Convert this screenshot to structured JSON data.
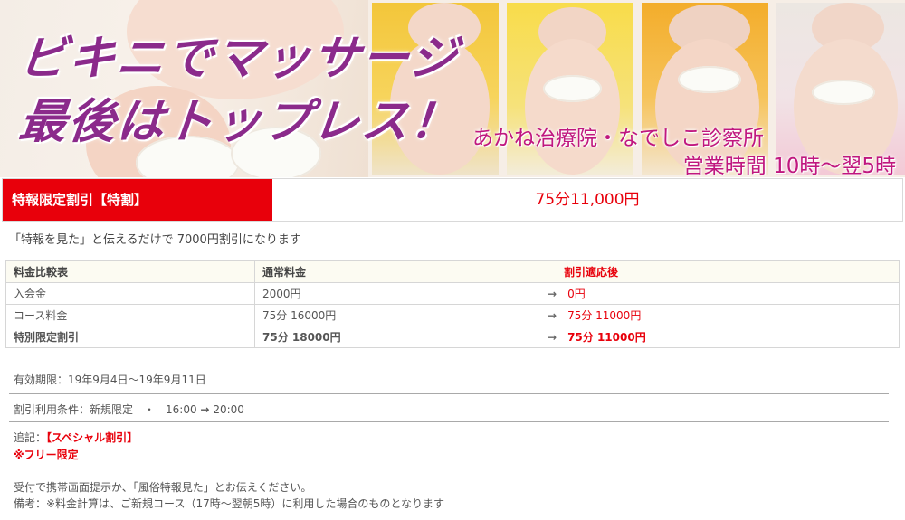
{
  "banner": {
    "catch_line1": "ビキニでマッサージ",
    "catch_line2": "最後はトップレス！",
    "shop_name": "あかね治療院・なでしこ診察所",
    "hours": "営業時間 10時～翌5時"
  },
  "special": {
    "label": "特報限定割引【特割】",
    "price": "75分11,000円"
  },
  "note": "「特報を見た」と伝えるだけで 7000円割引になります",
  "comparison": {
    "headers": [
      "料金比較表",
      "通常料金",
      "割引適応後"
    ],
    "rows": [
      {
        "item": "入会金",
        "normal": "2000円",
        "discounted": "0円"
      },
      {
        "item": "コース料金",
        "normal": "75分 16000円",
        "discounted": "75分 11000円"
      },
      {
        "item": "特別限定割引",
        "normal": "75分 18000円",
        "discounted": "75分 11000円"
      }
    ]
  },
  "details": {
    "validity": "有効期限：19年9月4日～19年9月11日",
    "condition_prefix": "割引利用条件：新規限定　・　16:00",
    "condition_suffix": "20:00",
    "note_prefix": "追記：",
    "note_special": "【スペシャル割引】",
    "free_limited": "※フリー限定",
    "reception": "受付で携帯画面提示か、「風俗特報見た」とお伝えください。",
    "remarks": "備考：※料金計算は、ご新規コース（17時～翌朝5時）に利用した場合のものとなります"
  },
  "colors": {
    "accent_red": "#e8000b",
    "catch_purple": "#8b2a8b",
    "shop_pink": "#c0177f"
  }
}
